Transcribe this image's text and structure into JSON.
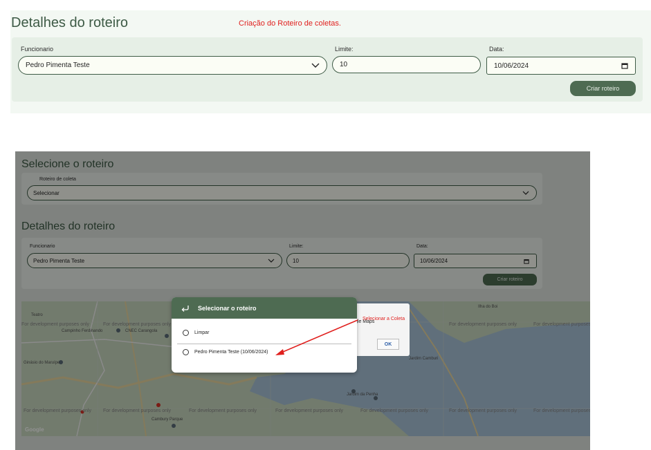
{
  "top": {
    "title": "Detalhes do roteiro",
    "annotation": "Criação do Roteiro de coletas.",
    "funcionario_label": "Funcionario",
    "funcionario_value": "Pedro Pimenta Teste",
    "limite_label": "Limite:",
    "limite_value": "10",
    "data_label": "Data:",
    "data_value": "10/06/2024",
    "criar_button": "Criar roteiro"
  },
  "inner": {
    "select_title": "Selecione o roteiro",
    "roteiro_label": "Roteiro de coleta",
    "roteiro_value": "Selecionar",
    "details_title": "Detalhes do roteiro",
    "funcionario_label": "Funcionario",
    "funcionario_value": "Pedro Pimenta Teste",
    "limite_label": "Limite:",
    "limite_value": "10",
    "data_label": "Data:",
    "data_value": "10/06/2024",
    "criar_button": "Criar roteiro"
  },
  "map": {
    "watermark": "For development purposes only",
    "google_logo": "Google",
    "google_maps_text": "gle Maps",
    "ok_button": "OK",
    "places": [
      "Teatro",
      "Campinho Ferdinando",
      "CNEC Carangola",
      "Ginásio do Maruípe",
      "Jardim Camburi",
      "Jardim da Penha",
      "Cambury Parque",
      "Ilha do Boi"
    ]
  },
  "modal": {
    "title": "Selecionar o roteiro",
    "options": [
      "Limpar",
      "Pedro Pimenta Teste (10/06/2024)"
    ]
  },
  "annotation_arrow": {
    "text": "Selecionar a Coleta",
    "color": "#e0201e"
  },
  "colors": {
    "accent": "#4e6b52",
    "title": "#3d5a45",
    "annotation": "#e0201e"
  }
}
